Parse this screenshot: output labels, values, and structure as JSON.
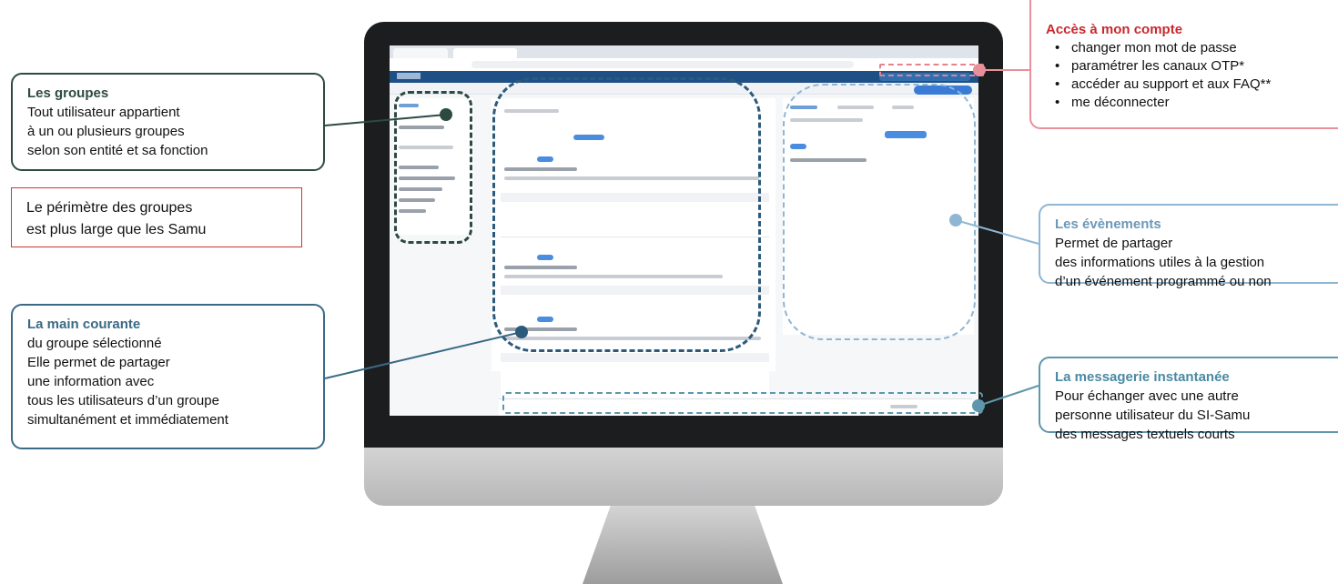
{
  "callouts": {
    "groupes": {
      "title": "Les groupes",
      "lines": [
        "Tout utilisateur appartient",
        "à un ou plusieurs groupes",
        "selon son entité et sa fonction"
      ]
    },
    "perimetre": {
      "lines": [
        "Le périmètre des groupes",
        "est plus large que les Samu"
      ]
    },
    "main_courante": {
      "title": "La main courante",
      "lines": [
        "du groupe sélectionné",
        "Elle permet de partager",
        "une information avec",
        "tous les utilisateurs d’un groupe",
        "simultanément et immédiatement"
      ]
    },
    "compte": {
      "title": "Accès à mon compte",
      "items": [
        "changer mon mot de passe",
        "paramétrer les canaux OTP*",
        "accéder au support et aux FAQ**",
        "me déconnecter"
      ]
    },
    "evenements": {
      "title": "Les évènements",
      "lines": [
        "Permet de partager",
        "des informations utiles à la gestion",
        "d’un événement programmé ou non"
      ]
    },
    "messagerie": {
      "title": "La messagerie instantanée",
      "lines": [
        "Pour échanger avec une autre",
        "personne utilisateur du SI-Samu",
        "des messages textuels courts"
      ]
    }
  },
  "colors": {
    "groupes": "#2d4a42",
    "main_courante": "#3a6a86",
    "compte_border": "#e8909a",
    "compte_title": "#c8282e",
    "evenements": "#8fb6d3",
    "messagerie": "#5e97ad",
    "perimetre_border": "#d0362f",
    "app_header": "#1e4f85"
  }
}
